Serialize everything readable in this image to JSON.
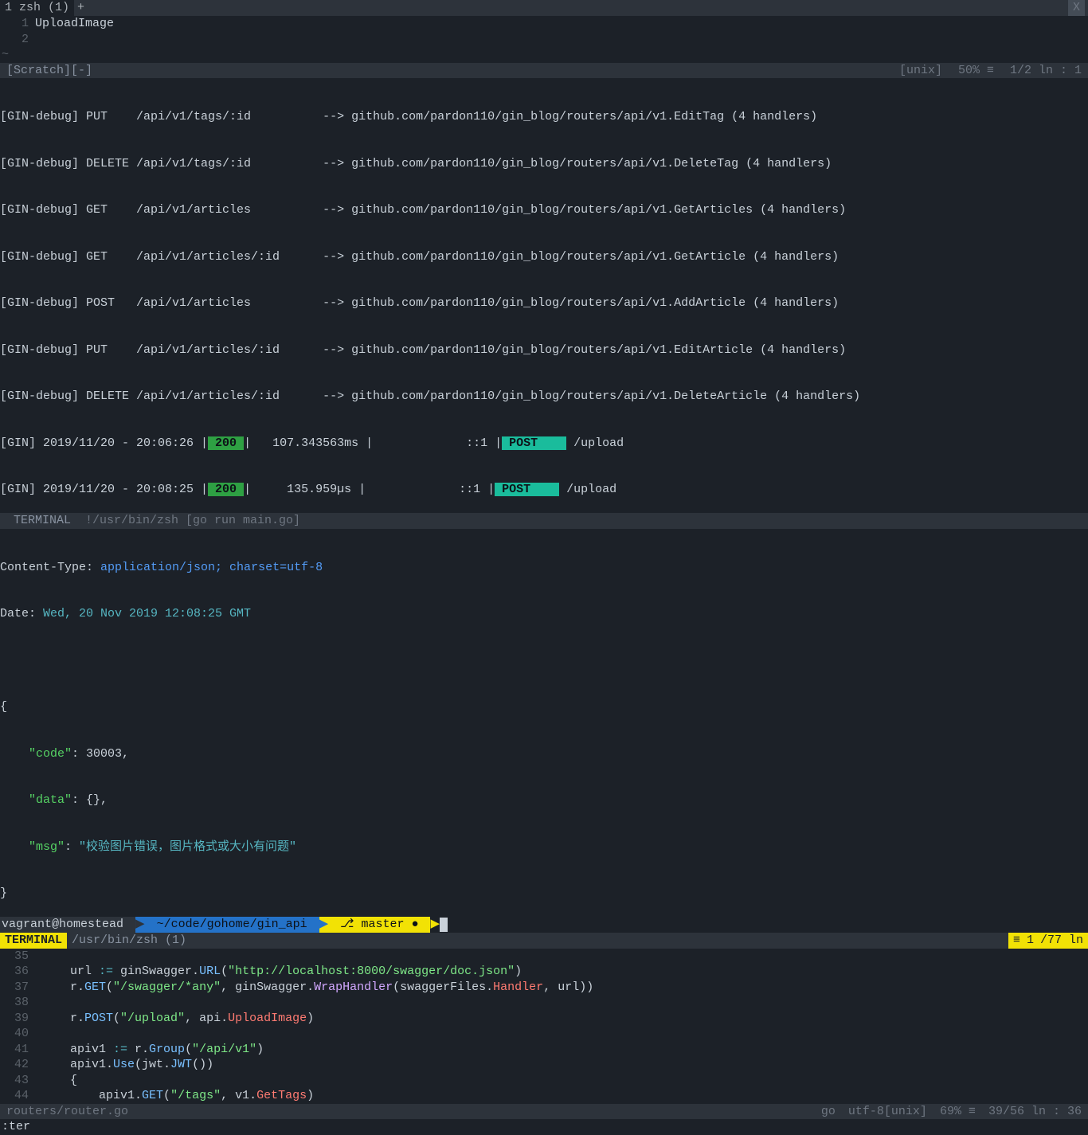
{
  "tabbar": {
    "tab1": "1 zsh (1)",
    "add": "+",
    "close": "X"
  },
  "top": {
    "lines": [
      {
        "num": "1",
        "text": "UploadImage"
      },
      {
        "num": "2",
        "text": ""
      }
    ],
    "tilde": "~"
  },
  "status1": {
    "left": "[Scratch][-]",
    "unix": "[unix]",
    "pct": "50% ≡",
    "pos": "1/2 ln :  1"
  },
  "gin": {
    "l1": "[GIN-debug] PUT    /api/v1/tags/:id          --> github.com/pardon110/gin_blog/routers/api/v1.EditTag (4 handlers)",
    "l2": "[GIN-debug] DELETE /api/v1/tags/:id          --> github.com/pardon110/gin_blog/routers/api/v1.DeleteTag (4 handlers)",
    "l3": "[GIN-debug] GET    /api/v1/articles          --> github.com/pardon110/gin_blog/routers/api/v1.GetArticles (4 handlers)",
    "l4": "[GIN-debug] GET    /api/v1/articles/:id      --> github.com/pardon110/gin_blog/routers/api/v1.GetArticle (4 handlers)",
    "l5": "[GIN-debug] POST   /api/v1/articles          --> github.com/pardon110/gin_blog/routers/api/v1.AddArticle (4 handlers)",
    "l6": "[GIN-debug] PUT    /api/v1/articles/:id      --> github.com/pardon110/gin_blog/routers/api/v1.EditArticle (4 handlers)",
    "l7": "[GIN-debug] DELETE /api/v1/articles/:id      --> github.com/pardon110/gin_blog/routers/api/v1.DeleteArticle (4 handlers)",
    "r1a": "[GIN] 2019/11/20 - 20:06:26 |",
    "r1s": " 200 ",
    "r1b": "|   107.343563ms |             ::1 |",
    "r1p": " POST    ",
    "r1c": " /upload",
    "r2a": "[GIN] 2019/11/20 - 20:08:25 |",
    "r2s": " 200 ",
    "r2b": "|     135.959µs |             ::1 |",
    "r2p": " POST    ",
    "r2c": " /upload"
  },
  "termbar": {
    "label": " TERMINAL ",
    "cmd": " !/usr/bin/zsh [go run main.go]"
  },
  "resp": {
    "ct_key": "Content-Type:",
    "ct_val": " application/json; charset=utf-8",
    "date_key": "Date:",
    "date_val": " Wed, 20 Nov 2019 12:08:25 GMT",
    "open": "{",
    "code_k": "    \"code\"",
    "code_v": ": 30003",
    "comma": ",",
    "data_k": "    \"data\"",
    "data_v": ": {}",
    "msg_k": "    \"msg\"",
    "msg_v": "\"校验图片错误，图片格式或大小有问题\"",
    "close": "}"
  },
  "prompt": {
    "user": "vagrant@homestead ",
    "path": " ~/code/gohome/gin_api ",
    "branch": " ⎇ master ● "
  },
  "termstat": {
    "label": " TERMINAL ",
    "path": "/usr/bin/zsh (1)",
    "r1": "≡",
    "r2": "1",
    "r3": "/77 ln"
  },
  "ed": {
    "l35n": "35",
    "l36n": "36",
    "l37n": "37",
    "l38n": "38",
    "l39n": "39",
    "l40n": "40",
    "l41n": "41",
    "l42n": "42",
    "l43n": "43",
    "l44n": "44",
    "l36": {
      "a": "    url ",
      "op": ":=",
      "b": " ginSwagger.",
      "m": "URL",
      "c": "(",
      "s": "\"http://localhost:8000/swagger/doc.json\"",
      "d": ")"
    },
    "l37": {
      "a": "    r.",
      "m": "GET",
      "b": "(",
      "s": "\"/swagger/*any\"",
      "c": ", ginSwagger.",
      "m2": "WrapHandler",
      "d": "(swaggerFiles.",
      "i": "Handler",
      "e": ", url))"
    },
    "l39": {
      "a": "    r.",
      "m": "POST",
      "b": "(",
      "s": "\"/upload\"",
      "c": ", api.",
      "i": "UploadImage",
      "d": ")"
    },
    "l41": {
      "a": "    apiv1 ",
      "op": ":=",
      "b": " r.",
      "m": "Group",
      "c": "(",
      "s": "\"/api/v1\"",
      "d": ")"
    },
    "l42": {
      "a": "    apiv1.",
      "m": "Use",
      "b": "(jwt.",
      "m2": "JWT",
      "c": "())"
    },
    "l43": {
      "a": "    {"
    },
    "l44": {
      "a": "        apiv1.",
      "m": "GET",
      "b": "(",
      "s": "\"/tags\"",
      "c": ", v1.",
      "i": "GetTags",
      "d": ")"
    }
  },
  "bstat": {
    "file": " routers/router.go",
    "lang": "go",
    "enc": "utf-8[unix]",
    "pct": "69% ≡",
    "pos": "39/56 ln : 36"
  },
  "cmd": ":ter"
}
